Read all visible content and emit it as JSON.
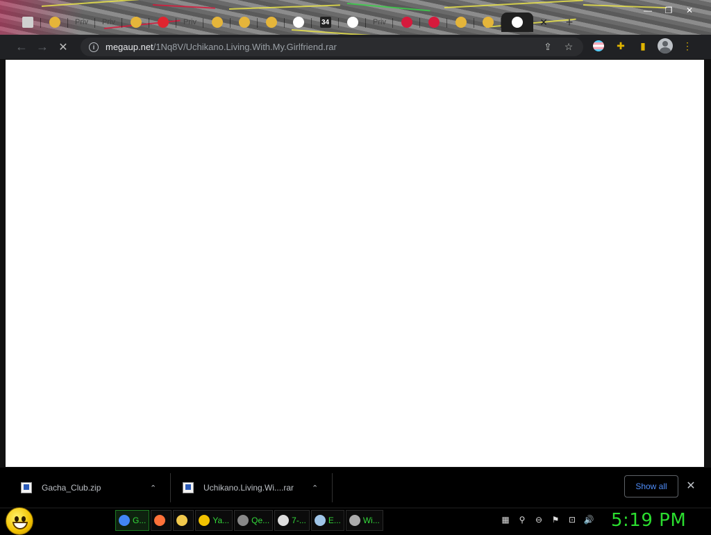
{
  "browser": {
    "tabs": [
      {
        "icon": "app-icon",
        "color": "#d0d0d0",
        "text": ""
      },
      {
        "icon": "chrome-color-icon",
        "color": "#e5b53a",
        "text": ""
      },
      {
        "icon": "text",
        "color": "",
        "text": "Priv"
      },
      {
        "icon": "text",
        "color": "",
        "text": "Priv"
      },
      {
        "icon": "globe-icon",
        "color": "#e5b53a",
        "text": ""
      },
      {
        "icon": "m-logo-icon",
        "color": "#e0242f",
        "text": ""
      },
      {
        "icon": "text",
        "color": "",
        "text": "Priv"
      },
      {
        "icon": "globe-icon",
        "color": "#e5b53a",
        "text": ""
      },
      {
        "icon": "globe-icon",
        "color": "#e5b53a",
        "text": ""
      },
      {
        "icon": "globe-icon",
        "color": "#e5b53a",
        "text": ""
      },
      {
        "icon": "google-icon",
        "color": "#4285f4",
        "text": ""
      },
      {
        "icon": "counter-icon",
        "color": "#222",
        "text": "34"
      },
      {
        "icon": "google-icon",
        "color": "#4285f4",
        "text": ""
      },
      {
        "icon": "text",
        "color": "",
        "text": "Priv"
      },
      {
        "icon": "red-icon",
        "color": "#d61a3c",
        "text": ""
      },
      {
        "icon": "red-icon",
        "color": "#d61a3c",
        "text": ""
      },
      {
        "icon": "globe-icon",
        "color": "#e5b53a",
        "text": ""
      },
      {
        "icon": "globe-icon",
        "color": "#e5b53a",
        "text": ""
      },
      {
        "icon": "google-icon",
        "color": "#4285f4",
        "text": "",
        "active": true
      }
    ],
    "tab_close_glyph": "✕",
    "new_tab_glyph": "+",
    "window_controls": {
      "minimize": "—",
      "maximize": "❐",
      "close": "✕"
    },
    "toolbar": {
      "back_glyph": "←",
      "forward_glyph": "→",
      "stop_glyph": "✕",
      "info_glyph": "i",
      "url_host": "megaup.net",
      "url_path": "/1Nq8V/Uchikano.Living.With.My.Girlfriend.rar",
      "share_glyph": "⇪",
      "star_glyph": "☆",
      "extensions_glyph": "✚",
      "sidepanel_glyph": "▮",
      "menu_glyph": "⋮"
    }
  },
  "downloads": {
    "items": [
      {
        "name": "Gacha_Club.zip",
        "chevron": "⌃"
      },
      {
        "name": "Uchikano.Living.Wi....rar",
        "chevron": "⌃"
      }
    ],
    "show_all": "Show all",
    "close_glyph": "✕"
  },
  "taskbar": {
    "tasks": [
      {
        "label": "G...",
        "icon_color": "#4285f4",
        "active": true
      },
      {
        "label": "",
        "icon_color": "#ff7139"
      },
      {
        "label": "",
        "icon_color": "#f2c94c"
      },
      {
        "label": "Ya...",
        "icon_color": "#f2c200"
      },
      {
        "label": "Qe...",
        "icon_color": "#888"
      },
      {
        "label": "7-...",
        "icon_color": "#ddd"
      },
      {
        "label": "E...",
        "icon_color": "#9fc5e8"
      },
      {
        "label": "Wi...",
        "icon_color": "#aaa"
      }
    ],
    "tray_glyphs": [
      "▦",
      "⚲",
      "⊖",
      "⚑",
      "⊡",
      "🔊"
    ],
    "clock": "5:19 PM"
  }
}
